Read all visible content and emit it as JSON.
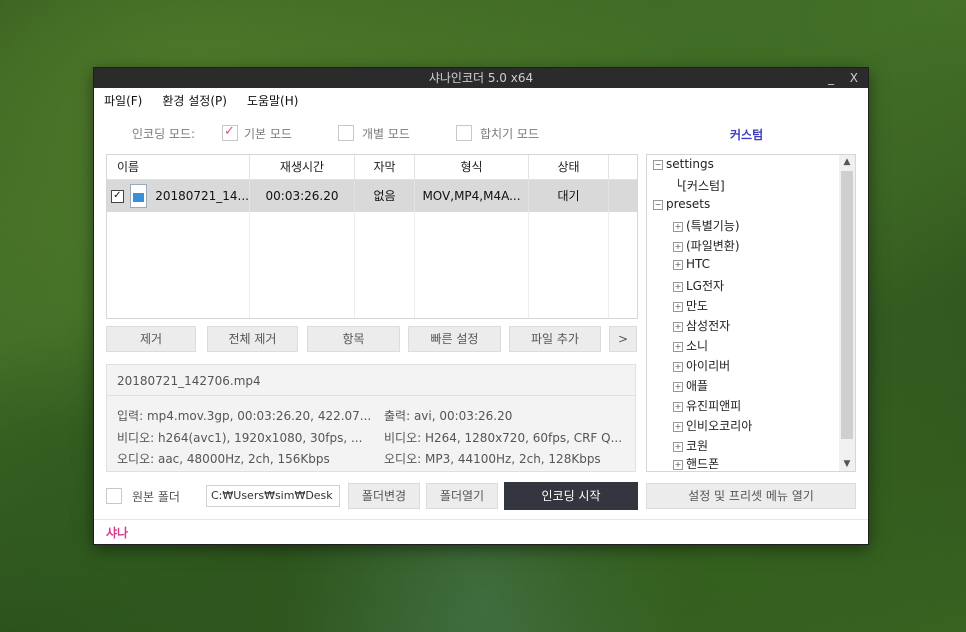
{
  "window": {
    "title": "샤나인코더  5.0  x64",
    "minimize": "_",
    "close": "X"
  },
  "menu": [
    "파일(F)",
    "환경 설정(P)",
    "도움말(H)"
  ],
  "mode": {
    "label": "인코딩 모드:",
    "options": [
      {
        "label": "기본 모드",
        "checked": true
      },
      {
        "label": "개별 모드",
        "checked": false
      },
      {
        "label": "합치기 모드",
        "checked": false
      }
    ],
    "custom": "커스텀"
  },
  "filelist": {
    "headers": [
      "이름",
      "재생시간",
      "자막",
      "형식",
      "상태"
    ],
    "rows": [
      {
        "name": "20180721_14...",
        "duration": "00:03:26.20",
        "subtitle": "없음",
        "format": "MOV,MP4,M4A...",
        "status": "대기",
        "checked": true
      }
    ]
  },
  "buttons": {
    "remove": "제거",
    "remove_all": "전체 제거",
    "items": "항목",
    "quick": "빠른 설정",
    "add_file": "파일 추가",
    "more": ">"
  },
  "info": {
    "filename": "20180721_142706.mp4",
    "input": "입력: mp4.mov.3gp, 00:03:26.20, 422.07...",
    "input_video": "비디오: h264(avc1), 1920x1080, 30fps, ...",
    "input_audio": "오디오: aac, 48000Hz, 2ch, 156Kbps",
    "output": "출력: avi, 00:03:26.20",
    "output_video": "비디오: H264, 1280x720, 60fps, CRF Q...",
    "output_audio": "오디오: MP3, 44100Hz, 2ch, 128Kbps"
  },
  "tree": {
    "settings": "settings",
    "custom": "[커스텀]",
    "presets": "presets",
    "items": [
      "(특별기능)",
      "(파일변환)",
      "HTC",
      "LG전자",
      "만도",
      "삼성전자",
      "소니",
      "아이리버",
      "애플",
      "유진피앤피",
      "인비오코리아",
      "코원",
      "핸드폰"
    ]
  },
  "bottom": {
    "original_folder": "원본 폴더",
    "path": "C:₩Users₩sim₩Desk",
    "change_folder": "폴더변경",
    "open_folder": "폴더열기",
    "start": "인코딩 시작",
    "open_settings": "설정 및 프리셋 메뉴 열기"
  },
  "status": {
    "text": "샤나"
  }
}
